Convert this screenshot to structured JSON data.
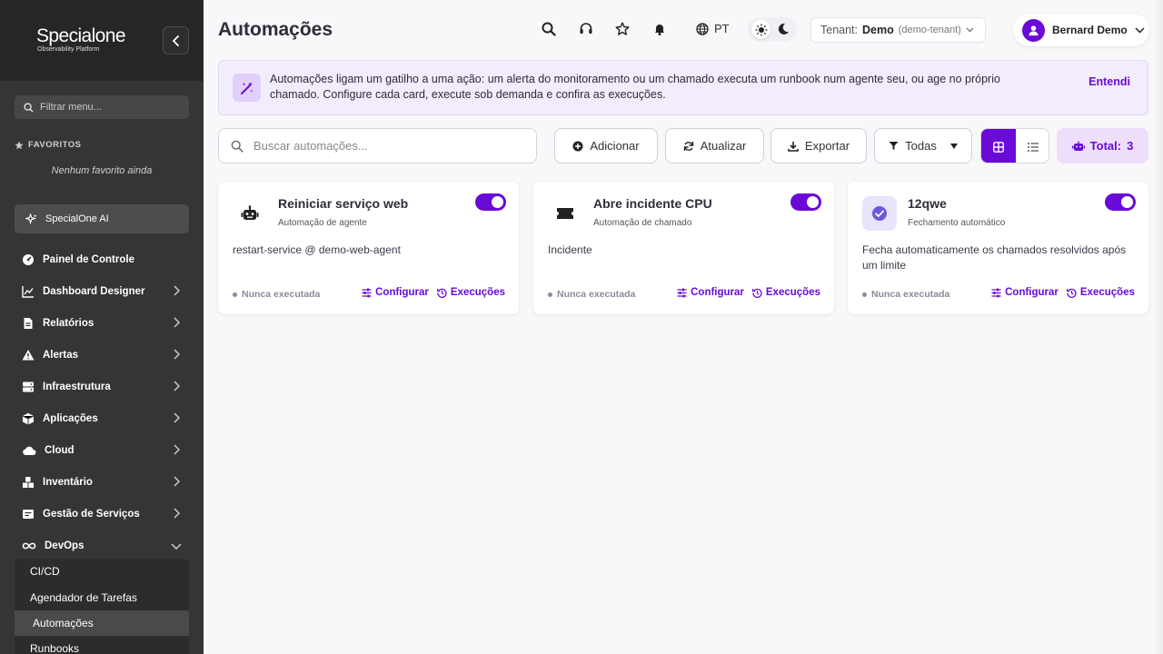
{
  "brand": {
    "name": "Specialone",
    "tagline": "Observability Platform"
  },
  "sidebar": {
    "filter_placeholder": "Filtrar menu...",
    "favorites_title": "FAVORITOS",
    "favorites_empty": "Nenhum favorito ainda",
    "ai_label": "SpecialOne AI",
    "items": [
      {
        "label": "Painel de Controle",
        "icon": "gauge-icon",
        "expandable": false
      },
      {
        "label": "Dashboard Designer",
        "icon": "chart-line-icon",
        "expandable": true
      },
      {
        "label": "Relatórios",
        "icon": "document-icon",
        "expandable": true
      },
      {
        "label": "Alertas",
        "icon": "warning-icon",
        "expandable": true
      },
      {
        "label": "Infraestrutura",
        "icon": "server-icon",
        "expandable": true
      },
      {
        "label": "Aplicações",
        "icon": "cube-icon",
        "expandable": true
      },
      {
        "label": "Cloud",
        "icon": "cloud-icon",
        "expandable": true
      },
      {
        "label": "Inventário",
        "icon": "boxes-icon",
        "expandable": true
      },
      {
        "label": "Gestão de Serviços",
        "icon": "service-icon",
        "expandable": true
      },
      {
        "label": "DevOps",
        "icon": "infinity-icon",
        "expandable": true,
        "expanded": true
      }
    ],
    "devops_sub": [
      "CI/CD",
      "Agendador de Tarefas",
      "Automações",
      "Runbooks"
    ],
    "active_sub": "Automações"
  },
  "header": {
    "title": "Automações",
    "lang": "PT",
    "tenant_label": "Tenant:",
    "tenant_name": "Demo",
    "tenant_id": "(demo-tenant)",
    "user_name": "Bernard Demo"
  },
  "banner": {
    "text": "Automações ligam um gatilho a uma ação: um alerta do monitoramento ou um chamado executa um runbook num agente seu, ou age no próprio chamado. Configure cada card, execute sob demanda e confira as execuções.",
    "dismiss": "Entendi"
  },
  "toolbar": {
    "search_placeholder": "Buscar automações...",
    "add": "Adicionar",
    "refresh": "Atualizar",
    "export": "Exportar",
    "filter": "Todas",
    "total_label": "Total:",
    "total_value": "3"
  },
  "cards": [
    {
      "name": "Reiniciar serviço web",
      "type": "Automação de agente",
      "desc": "restart-service @ demo-web-agent",
      "enabled": true,
      "status": "Nunca executada",
      "configure": "Configurar",
      "runs": "Execuções",
      "icon": "robot-icon"
    },
    {
      "name": "Abre incidente CPU",
      "type": "Automação de chamado",
      "desc": "Incidente",
      "enabled": true,
      "status": "Nunca executada",
      "configure": "Configurar",
      "runs": "Execuções",
      "icon": "ticket-icon"
    },
    {
      "name": "12qwe",
      "type": "Fechamento automático",
      "desc": "Fecha automaticamente os chamados resolvidos após um limite",
      "enabled": true,
      "status": "Nunca executada",
      "configure": "Configurar",
      "runs": "Execuções",
      "icon": "check-circle-icon"
    }
  ],
  "colors": {
    "accent": "#6a0ad8",
    "sidebar": "#353535",
    "banner": "#f3ecfd"
  }
}
